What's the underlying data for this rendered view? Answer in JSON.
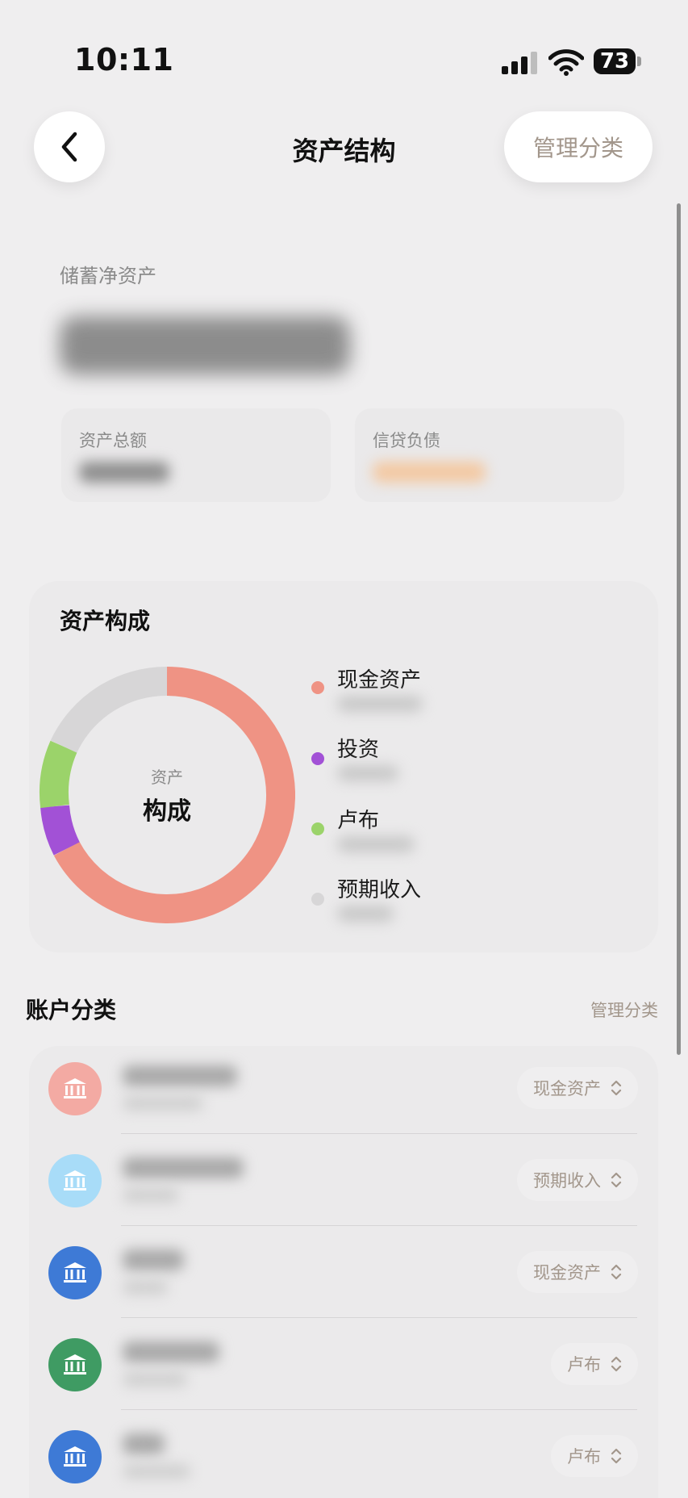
{
  "status_bar": {
    "time": "10:11",
    "battery": "73"
  },
  "nav": {
    "title": "资产结构",
    "manage_label": "管理分类"
  },
  "savings": {
    "net_label": "储蓄净资产",
    "total_assets_label": "资产总额",
    "credit_debt_label": "信贷负债"
  },
  "composition": {
    "title": "资产构成",
    "center_small": "资产",
    "center_big": "构成",
    "legend": [
      {
        "name": "现金资产",
        "color": "#ef9384"
      },
      {
        "name": "投资",
        "color": "#a251d6"
      },
      {
        "name": "卢布",
        "color": "#9bd36a"
      },
      {
        "name": "预期收入",
        "color": "#d7d6d7"
      }
    ]
  },
  "accounts": {
    "title": "账户分类",
    "manage_label": "管理分类",
    "rows": [
      {
        "icon_color": "#f3aaa3",
        "category": "现金资产"
      },
      {
        "icon_color": "#a8dcf8",
        "category": "预期收入"
      },
      {
        "icon_color": "#3e7ad6",
        "category": "现金资产"
      },
      {
        "icon_color": "#3f9b63",
        "category": "卢布"
      },
      {
        "icon_color": "#3e7ad6",
        "category": "卢布"
      }
    ]
  }
}
